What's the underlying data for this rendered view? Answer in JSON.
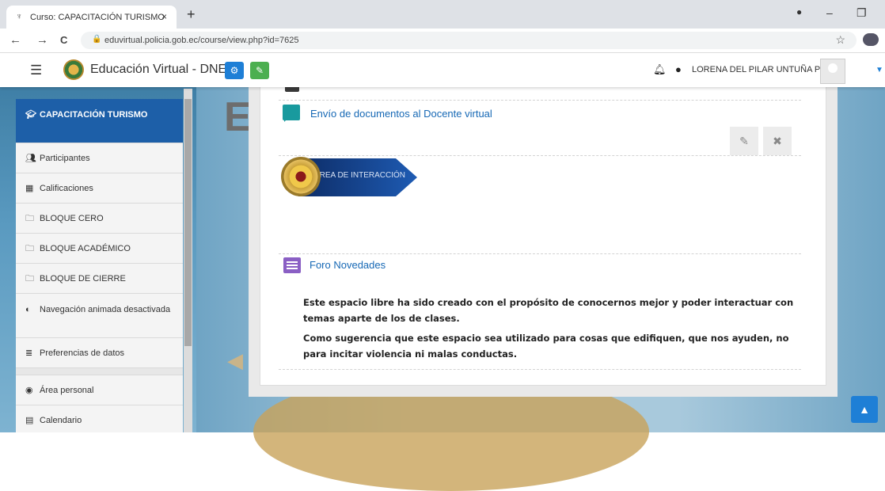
{
  "browser": {
    "tab_title": "Curso: CAPACITACIÓN TURISMO",
    "tab_close": "×",
    "new_tab": "+",
    "url": "eduvirtual.policia.gob.ec/course/view.php?id=7625",
    "back": "←",
    "forward": "→",
    "reload": "C",
    "star": "☆",
    "minimize": "–",
    "restore": "❐"
  },
  "navbar": {
    "brand": "Educación Virtual - DNE",
    "user_name": "LORENA DEL PILAR UNTUÑA PUMA",
    "menu_icon": "☰"
  },
  "sidebar": {
    "course": "CAPACITACIÓN TURISMO",
    "items": [
      {
        "label": "Participantes",
        "icon": "users-icon"
      },
      {
        "label": "Calificaciones",
        "icon": "table-icon"
      },
      {
        "label": "BLOQUE CERO",
        "icon": "folder-icon"
      },
      {
        "label": "BLOQUE ACADÉMICO",
        "icon": "folder-icon"
      },
      {
        "label": "BLOQUE DE CIERRE",
        "icon": "folder-icon"
      },
      {
        "label": "Navegación animada desactivada",
        "icon": "toggle-icon"
      },
      {
        "label": "Preferencias de datos",
        "icon": "database-icon"
      }
    ],
    "items2": [
      {
        "label": "Área personal",
        "icon": "dashboard-icon"
      },
      {
        "label": "Calendario",
        "icon": "calendar-icon"
      }
    ]
  },
  "main": {
    "bg_letter": "E",
    "activity1": "Envío de documentos al Docente virtual",
    "banner_text": "ÁREA DE INTERACCIÓN",
    "activity2": "Foro Novedades",
    "paragraph1": "Este espacio libre ha sido creado con el propósito de conocernos mejor y poder interactuar con temas aparte de los de clases.",
    "paragraph2": "Como sugerencia que este espacio sea utilizado para cosas que edifiquen, que nos ayuden, no para incitar violencia ni malas conductas."
  },
  "colors": {
    "primary": "#1d5fa8",
    "link": "#1668b5",
    "chat_icon": "#199a9e",
    "forum_icon": "#8a5fc4"
  }
}
